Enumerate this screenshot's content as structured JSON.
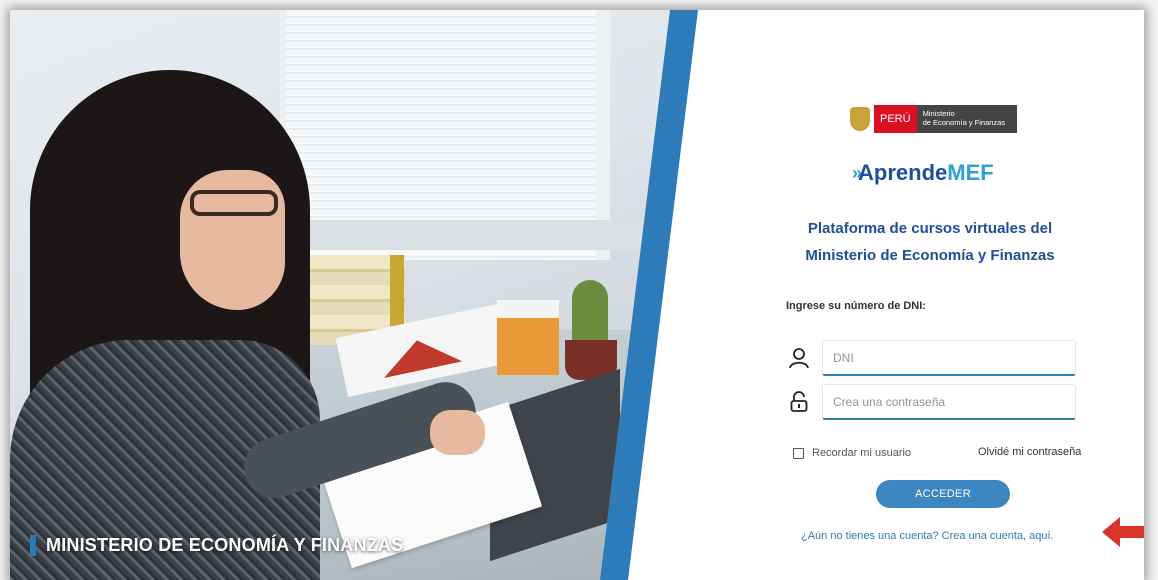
{
  "left": {
    "caption": "MINISTERIO DE ECONOMÍA Y FINANZAS"
  },
  "logo": {
    "peru_label": "PERÚ",
    "ministry_line1": "Ministerio",
    "ministry_line2": "de Economía y Finanzas"
  },
  "brand": {
    "arrows": "»",
    "prefix": "Aprende",
    "suffix": "MEF"
  },
  "headline": {
    "line1": "Plataforma de cursos virtuales del",
    "line2": "Ministerio de Economía y Finanzas"
  },
  "form": {
    "dni_label": "Ingrese su número de DNI:",
    "dni_placeholder": "DNI",
    "password_placeholder": "Crea una contraseña",
    "remember_label": "Recordar mi usuario",
    "forgot_link": "Olvidé mi contraseña",
    "submit_label": "ACCEDER",
    "signup_link": "¿Aún no tienes una cuenta? Crea una cuenta, aquí."
  },
  "colors": {
    "primary": "#1d4f9a",
    "accent": "#2f9fd8",
    "button": "#3c86c1",
    "stripe": "#2d7bb8",
    "arrow": "#d9342b"
  },
  "icons": [
    "user-icon",
    "lock-icon",
    "checkbox-icon",
    "arrow-left-icon",
    "peru-shield-icon"
  ]
}
